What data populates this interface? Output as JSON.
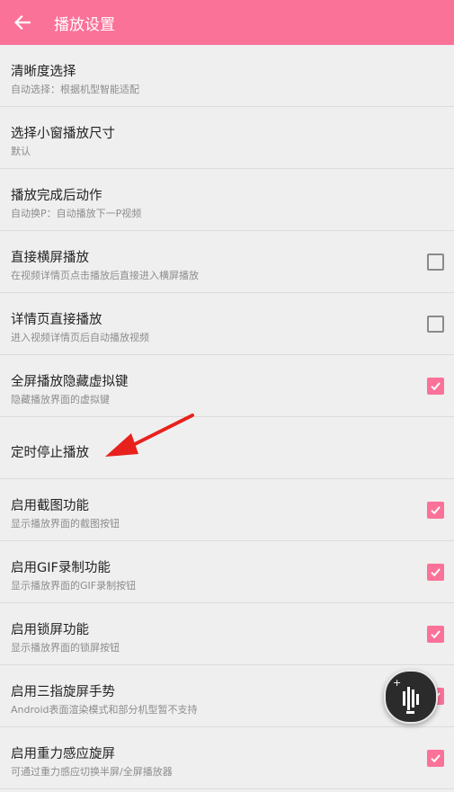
{
  "appbar": {
    "title": "播放设置",
    "back_icon": "arrow-left-icon"
  },
  "settings": [
    {
      "title": "清晰度选择",
      "subtitle": "自动选择：根据机型智能适配",
      "checkbox": null
    },
    {
      "title": "选择小窗播放尺寸",
      "subtitle": "默认",
      "checkbox": null
    },
    {
      "title": "播放完成后动作",
      "subtitle": "自动换P：自动播放下一P视频",
      "checkbox": null
    },
    {
      "title": "直接横屏播放",
      "subtitle": "在视频详情页点击播放后直接进入横屏播放",
      "checkbox": false
    },
    {
      "title": "详情页直接播放",
      "subtitle": "进入视频详情页后自动播放视频",
      "checkbox": false
    },
    {
      "title": "全屏播放隐藏虚拟键",
      "subtitle": "隐藏播放界面的虚拟键",
      "checkbox": true
    },
    {
      "title": "定时停止播放",
      "subtitle": "",
      "checkbox": null
    },
    {
      "title": "启用截图功能",
      "subtitle": "显示播放界面的截图按钮",
      "checkbox": true
    },
    {
      "title": "启用GIF录制功能",
      "subtitle": "显示播放界面的GIF录制按钮",
      "checkbox": true
    },
    {
      "title": "启用锁屏功能",
      "subtitle": "显示播放界面的锁屏按钮",
      "checkbox": true
    },
    {
      "title": "启用三指旋屏手势",
      "subtitle": "Android表面渲染模式和部分机型暂不支持",
      "checkbox": true
    },
    {
      "title": "启用重力感应旋屏",
      "subtitle": "可通过重力感应切换半屏/全屏播放器",
      "checkbox": true
    }
  ],
  "colors": {
    "accent": "#fb7299",
    "annotation": "#e8211d"
  },
  "floating_button": {
    "icon": "audio-wave-icon"
  }
}
